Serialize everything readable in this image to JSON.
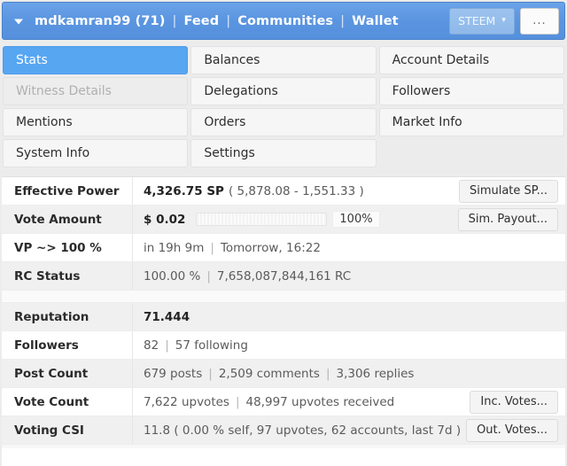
{
  "header": {
    "caret_icon": "caret-down-icon",
    "username": "mdkamran99 (71)",
    "links": [
      "Feed",
      "Communities",
      "Wallet"
    ],
    "separator": "|",
    "chain": "STEEM",
    "chain_caret": "▾",
    "more_label": "...",
    "accent_color": "#5590dd"
  },
  "tabs": [
    {
      "label": "Stats",
      "state": "selected"
    },
    {
      "label": "Balances",
      "state": "normal"
    },
    {
      "label": "Account Details",
      "state": "normal"
    },
    {
      "label": "Witness Details",
      "state": "disabled"
    },
    {
      "label": "Delegations",
      "state": "normal"
    },
    {
      "label": "Followers",
      "state": "normal"
    },
    {
      "label": "Mentions",
      "state": "normal"
    },
    {
      "label": "Orders",
      "state": "normal"
    },
    {
      "label": "Market Info",
      "state": "normal"
    },
    {
      "label": "System Info",
      "state": "normal"
    },
    {
      "label": "Settings",
      "state": "normal"
    },
    {
      "label": "",
      "state": "empty"
    }
  ],
  "stats": {
    "section1": [
      {
        "label": "Effective Power",
        "value_bold": "4,326.75 SP",
        "value_rest": "( 5,878.08 - 1,551.33 )",
        "action": "Simulate SP..."
      },
      {
        "label": "Vote Amount",
        "value_bold": "$ 0.02",
        "progress_pct": "100%",
        "progress_value": 100,
        "action": "Sim. Payout..."
      },
      {
        "label": "VP ~> 100 %",
        "part1": "in 19h 9m",
        "part2": "Tomorrow, 16:22"
      },
      {
        "label": "RC Status",
        "part1": "100.00 %",
        "part2": "7,658,087,844,161 RC"
      }
    ],
    "section2": [
      {
        "label": "Reputation",
        "value_bold": "71.444"
      },
      {
        "label": "Followers",
        "part1": "82",
        "part2": "57 following"
      },
      {
        "label": "Post Count",
        "part1": "679 posts",
        "part2": "2,509 comments",
        "part3": "3,306 replies"
      },
      {
        "label": "Vote Count",
        "part1": "7,622 upvotes",
        "part2": "48,997 upvotes received",
        "action": "Inc. Votes..."
      },
      {
        "label": "Voting CSI",
        "value_plain": "11.8 ( 0.00 % self, 97 upvotes, 62 accounts, last 7d )",
        "action": "Out. Votes..."
      }
    ]
  }
}
